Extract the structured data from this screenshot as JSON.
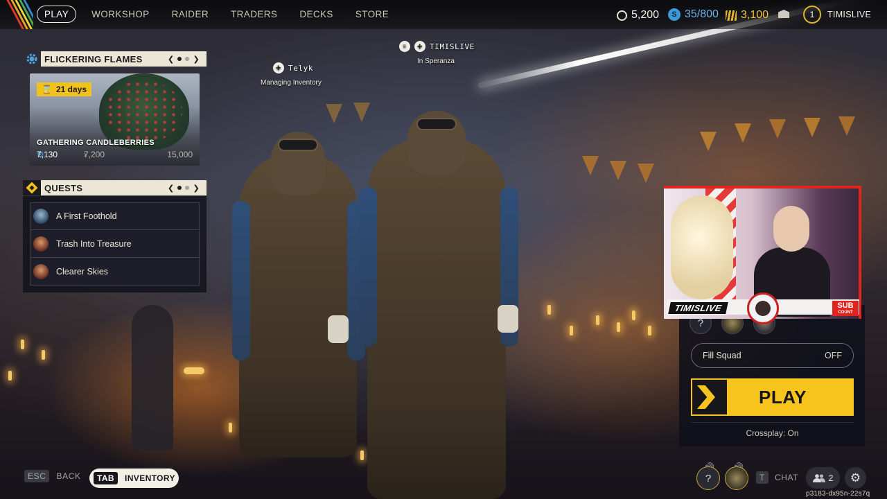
{
  "nav": {
    "items": [
      "PLAY",
      "WORKSHOP",
      "RAIDER",
      "TRADERS",
      "DECKS",
      "STORE"
    ],
    "active": "PLAY"
  },
  "currencies": {
    "coins": "5,200",
    "tokens": "35/800",
    "credits": "3,100"
  },
  "profile": {
    "rank": "1",
    "username": "TIMISLIVE"
  },
  "event": {
    "header": "FLICKERING FLAMES",
    "days_left": "21 days",
    "title": "GATHERING CANDLEBERRIES",
    "progress_current": "7,130",
    "milestone_1": "7,200",
    "milestone_2": "15,000",
    "progress_fraction": 0.475
  },
  "quests": {
    "header": "QUESTS",
    "items": [
      {
        "label": "A First Foothold",
        "color": "#4a7ea8"
      },
      {
        "label": "Trash Into Treasure",
        "color": "#9a4a3a"
      },
      {
        "label": "Clearer Skies",
        "color": "#9a4a3a"
      }
    ]
  },
  "party": {
    "member_left": {
      "name": "Telyk",
      "status": "Managing Inventory"
    },
    "member_center": {
      "name": "TIMISLIVE",
      "status": "In Speranza"
    }
  },
  "play_panel": {
    "fill_squad_label": "Fill Squad",
    "fill_squad_value": "OFF",
    "play_label": "PLAY",
    "crossplay": "Crossplay: On"
  },
  "stream": {
    "name": "TIMISLIVE",
    "sub_label": "SUB",
    "sub_sublabel": "COUNT"
  },
  "bottom": {
    "back_key": "ESC",
    "back_label": "BACK",
    "inventory_key": "TAB",
    "inventory_label": "INVENTORY",
    "chat_key": "T",
    "chat_label": "CHAT",
    "friends_count": "2",
    "build_id": "p3183-dx95n-22s7q"
  },
  "colors": {
    "accent_yellow": "#f6c41d",
    "panel_cream": "#ece6d6",
    "stream_red": "#e2241f"
  }
}
